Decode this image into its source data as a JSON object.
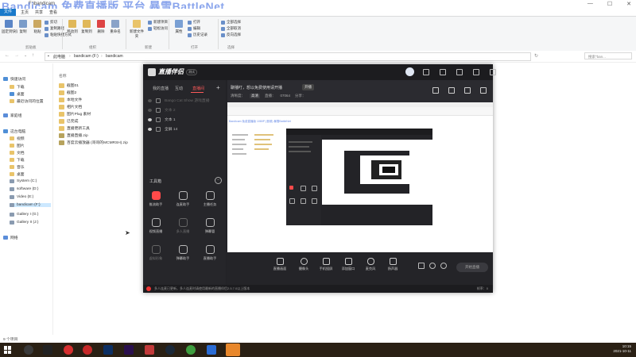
{
  "overlay_title": "Bandicam 免费直播版 平台 暴雪BattleNet",
  "explorer": {
    "window_title": "F:\\bandicam",
    "ribbon_tabs": [
      "文件",
      "主页",
      "共享",
      "查看"
    ],
    "ribbon": {
      "clipboard": {
        "pin": "固定到快速访问",
        "copy": "复制",
        "paste": "粘贴",
        "cut": "剪切",
        "copy_path": "复制路径",
        "paste_shortcut": "粘贴快捷方式",
        "group": "剪贴板"
      },
      "organize": {
        "move_to": "移动到",
        "copy_to": "复制到",
        "delete": "删除",
        "rename": "重命名",
        "group": "组织"
      },
      "new": {
        "new_folder": "新建文件夹",
        "new_item": "新建项目",
        "easy_access": "轻松访问",
        "group": "新建"
      },
      "open": {
        "properties": "属性",
        "open": "打开",
        "edit": "编辑",
        "history": "历史记录",
        "group": "打开"
      },
      "select": {
        "select_all": "全部选择",
        "select_none": "全部取消",
        "invert": "反向选择",
        "group": "选择"
      }
    },
    "address": {
      "root": "此电脑",
      "drive": "bandicam (F:)",
      "folder": "bandicam"
    },
    "search_placeholder": "搜索\"ban...",
    "nav": {
      "quick_access": "快速访问",
      "quick_items": [
        "下载",
        "桌面",
        "最近访问的位置"
      ],
      "homegroup": "家庭组",
      "this_pc": "这台电脑",
      "pc_items": [
        "视频",
        "图片",
        "文档",
        "下载",
        "音乐",
        "桌面"
      ],
      "drives": [
        "System (C:)",
        "software (D:)",
        "Video (E:)",
        "bandicam (F:)",
        "Gallery I (G:)",
        "Gallery II (J:)"
      ],
      "network": "网络"
    },
    "column_header": "名称",
    "files": [
      "截图01",
      "截图2",
      "本地文件",
      "相片文档",
      "图片Plug 素材",
      "已完成",
      "直播更新工具",
      "直播直播.zip",
      "百度云播放器 (哥哥的MCMRSH).zip"
    ],
    "status": "9 个项目"
  },
  "app": {
    "logo": "直播伴侣",
    "version_badge": "测试",
    "left_tabs": [
      "我的直播",
      "互动",
      "直播间"
    ],
    "sources": [
      {
        "label": "Bango Cat Show 游戏直播",
        "dim": true
      },
      {
        "label": "文本 2",
        "dim": true
      },
      {
        "label": "文本 1",
        "dim": false
      },
      {
        "label": "全屏 14",
        "dim": false
      }
    ],
    "toolbox_title": "工具箱",
    "tools": [
      {
        "label": "推流助手",
        "dim": false
      },
      {
        "label": "连麦助手",
        "dim": false
      },
      {
        "label": "主播任务",
        "dim": false
      },
      {
        "label": "视频直播",
        "dim": false
      },
      {
        "label": "多人直播",
        "dim": true
      },
      {
        "label": "弹幕管",
        "dim": false
      },
      {
        "label": "虚拟形象",
        "dim": true
      },
      {
        "label": "弹幕助手",
        "dim": false
      },
      {
        "label": "直播助手",
        "dim": false
      }
    ],
    "stage": {
      "notice": "聊播叮，想以免费使用请开播",
      "notice_pill": "开播",
      "row_labels": [
        "清晰度：",
        "高清",
        "直播：",
        "07064",
        "分享："
      ],
      "room_title": "Bandicam 免费直播版 1080P (音频) 暴雪BattleNet"
    },
    "bottom_buttons": [
      "直播画面",
      "摄像头",
      "手机投屏",
      "添加窗口",
      "麦克风",
      "扬声器"
    ],
    "start_label": "开始直播",
    "status_text": "多人连麦已更新，多人连麦时请使用最新的直播伴侣2.5.7.0以上版本",
    "status_right": "帧率：0"
  },
  "taskbar": {
    "time": "10:15",
    "date": "2021-10-11"
  }
}
